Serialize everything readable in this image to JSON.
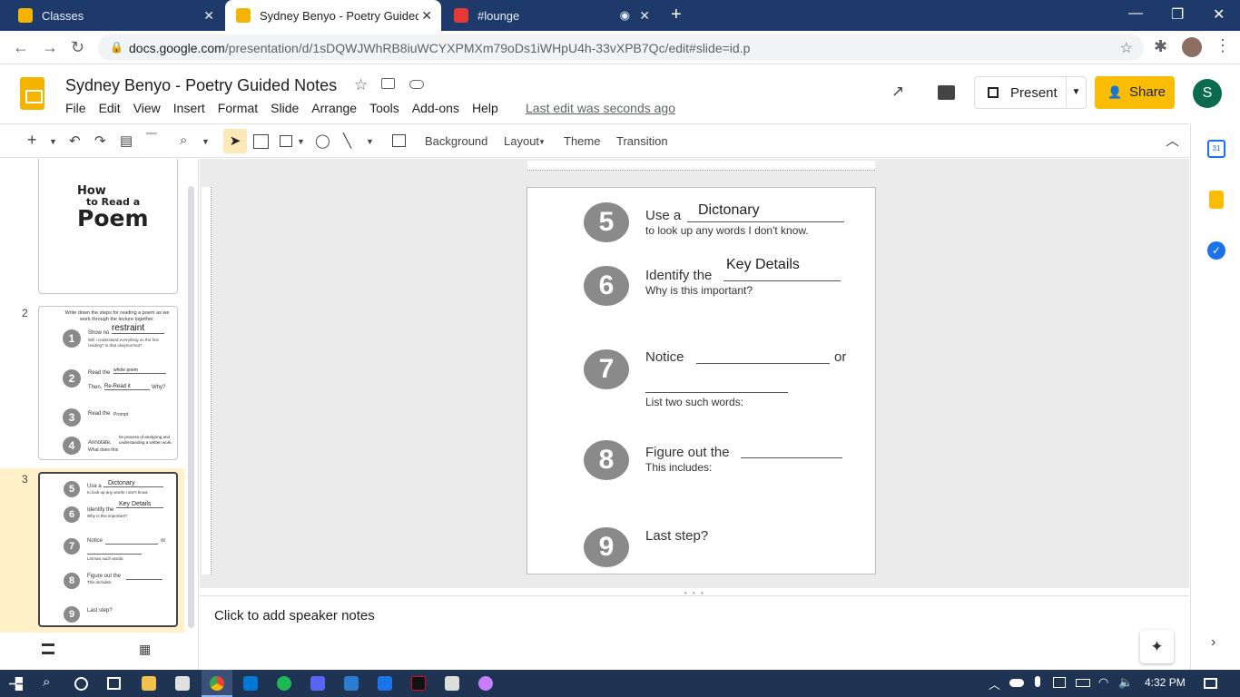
{
  "browser": {
    "tabs": [
      {
        "title": "Classes",
        "active": false
      },
      {
        "title": "Sydney Benyo - Poetry Guided N",
        "active": true
      },
      {
        "title": "#lounge",
        "active": false
      }
    ],
    "url_host": "docs.google.com",
    "url_path": "/presentation/d/1sDQWJWhRB8iuWCYXPMXm79oDs1iWHpU4h-33vXPB7Qc/edit#slide=id.p"
  },
  "app": {
    "title": "Sydney Benyo - Poetry Guided Notes",
    "menu": [
      "File",
      "Edit",
      "View",
      "Insert",
      "Format",
      "Slide",
      "Arrange",
      "Tools",
      "Add-ons",
      "Help"
    ],
    "last_edit": "Last edit was seconds ago",
    "present_label": "Present",
    "share_label": "Share",
    "avatar_letter": "S"
  },
  "toolbar": {
    "background": "Background",
    "layout": "Layout",
    "theme": "Theme",
    "transition": "Transition"
  },
  "filmstrip": {
    "slide_numbers": [
      "2",
      "3"
    ],
    "slide1": {
      "line1": "How",
      "line2": "to Read a",
      "line3": "Poem"
    },
    "slide2": {
      "intro": "Write down the steps for reading a poem as we work through the lecture together.",
      "s1": "Show no",
      "s1_answer": "restraint",
      "s1_sub": "Will I understand everything on the first reading? Is that okay/normal?",
      "s2": "Read the",
      "s2_answer": "whole poem",
      "s2_then": "Then,",
      "s2_then_answer": "Re-Read it",
      "s2_why": "Why?",
      "s3": "Read the",
      "s3_answer": "Prompt",
      "s4": "Annotate.",
      "s4_sub": "What does this",
      "s4_answer": "he process of analyzing and understanding a written work."
    },
    "slide3": {
      "s5": "Use a",
      "s5_answer": "Dictonary",
      "s5_sub": "to look up any words I don't know.",
      "s6": "Identify the",
      "s6_answer": "Key Details",
      "s6_sub": "Why is this important?",
      "s7": "Notice",
      "s7_or": "or",
      "s7_sub": "List two such words:",
      "s8": "Figure out the",
      "s8_sub": "This includes:",
      "s9": "Last step?"
    }
  },
  "slide": {
    "steps": [
      {
        "num": "5",
        "text": "Use a",
        "answer": "Dictonary",
        "sub": "to look up any words I don't know."
      },
      {
        "num": "6",
        "text": "Identify the",
        "answer": "Key Details",
        "sub": "Why is this important?"
      },
      {
        "num": "7",
        "text": "Notice",
        "or": "or",
        "sub": "List two such words:"
      },
      {
        "num": "8",
        "text": "Figure out the",
        "sub": "This includes:"
      },
      {
        "num": "9",
        "text": "Last step?"
      }
    ]
  },
  "notes_placeholder": "Click to add speaker notes",
  "taskbar": {
    "time": "4:32 PM"
  }
}
